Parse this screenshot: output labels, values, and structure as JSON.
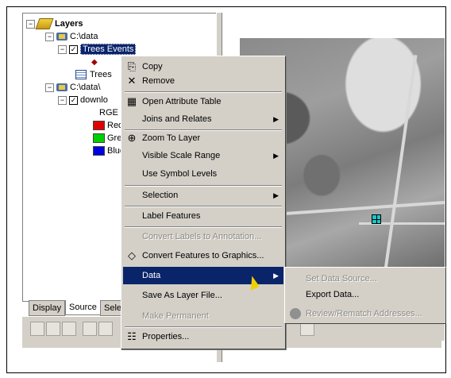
{
  "toc": {
    "root_label": "Layers",
    "source1": "C:\\data",
    "layer_selected": "Trees Events",
    "layer_trees": "Trees",
    "source2": "C:\\data\\",
    "raster_layer": "downlo",
    "rgb_label": "RGE",
    "bands": [
      {
        "label": "Red",
        "color": "#e00000"
      },
      {
        "label": "Gre",
        "color": "#00d000"
      },
      {
        "label": "Blue",
        "color": "#0000e0"
      }
    ]
  },
  "tabs": {
    "display": "Display",
    "source": "Source",
    "selection": "Sele"
  },
  "menu": {
    "copy": "Copy",
    "remove": "Remove",
    "open_attribute_table": "Open Attribute Table",
    "joins_relates": "Joins and Relates",
    "zoom_to_layer": "Zoom To Layer",
    "visible_scale_range": "Visible Scale Range",
    "use_symbol_levels": "Use Symbol Levels",
    "selection": "Selection",
    "label_features": "Label Features",
    "convert_labels": "Convert Labels to Annotation...",
    "convert_features": "Convert Features to Graphics...",
    "data": "Data",
    "save_as_layer_file": "Save As Layer File...",
    "make_permanent": "Make Permanent",
    "properties": "Properties..."
  },
  "submenu": {
    "set_data_source": "Set Data Source...",
    "export_data": "Export Data...",
    "review_rematch": "Review/Rematch Addresses..."
  },
  "colors": {
    "highlight": "#0a246a",
    "menu_bg": "#d4d0c8"
  }
}
